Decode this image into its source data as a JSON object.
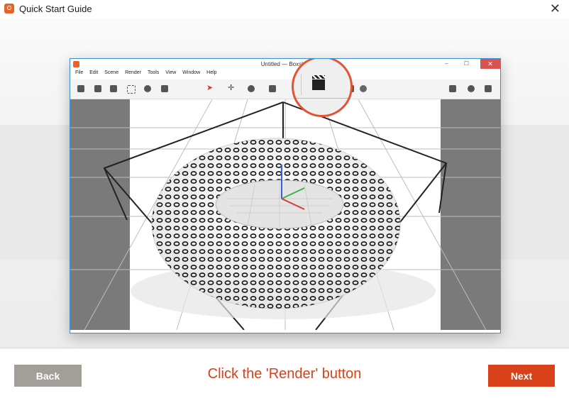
{
  "window": {
    "title": "Quick Start Guide",
    "close_glyph": "✕"
  },
  "screenshot": {
    "title": "Untitled — Boxshot",
    "close_glyph": "✕",
    "controls": "–  ☐",
    "menu": [
      "File",
      "Edit",
      "Scene",
      "Render",
      "Tools",
      "View",
      "Window",
      "Help"
    ],
    "toolbar_icons": [
      "tree-icon",
      "cube-icon",
      "sphere-icon",
      "frame-icon",
      "gear-icon",
      "camera-icon",
      "pointer-icon",
      "move-icon",
      "rotate-icon",
      "scale-icon",
      "render-clapper-icon",
      "light-icon",
      "add-cube-icon"
    ],
    "highlighted": "render-clapper-icon"
  },
  "footer": {
    "back_label": "Back",
    "instruction": "Click the 'Render' button",
    "next_label": "Next"
  },
  "colors": {
    "accent": "#d84119",
    "back_button": "#a29f98",
    "frame_border": "#3b8fd6"
  }
}
